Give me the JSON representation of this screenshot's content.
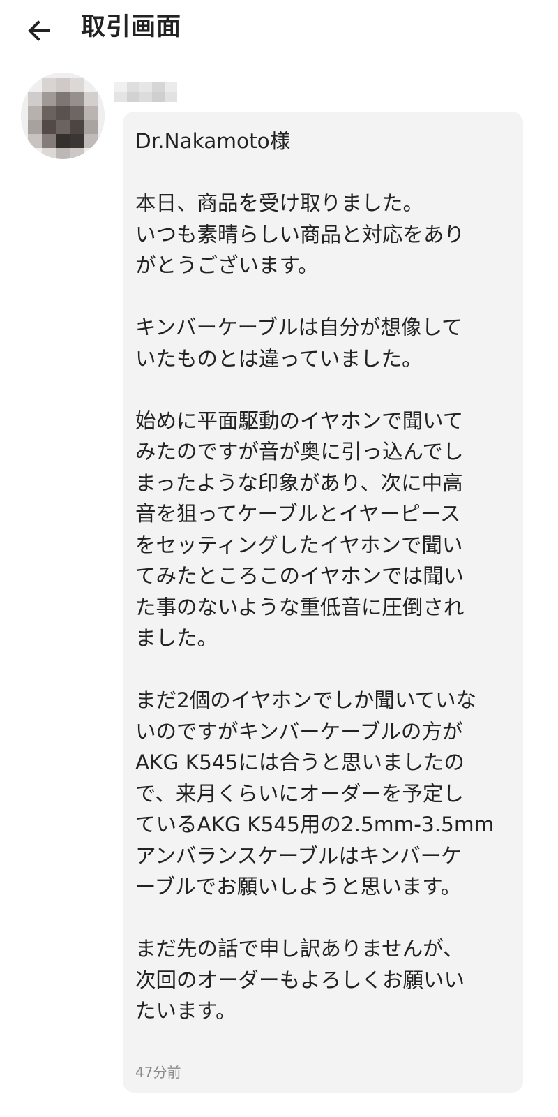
{
  "app_bar": {
    "title": "取引画面",
    "back_icon": "arrow-left-icon"
  },
  "message": {
    "sender": {
      "avatar_icon": "avatar",
      "name_pixelated": true
    },
    "text": "Dr.Nakamoto様\n\n本日、商品を受け取りました。\nいつも素晴らしい商品と対応をあり\nがとうございます。\n\nキンバーケーブルは自分が想像して\nいたものとは違っていました。\n\n始めに平面駆動のイヤホンで聞いて\nみたのですが音が奥に引っ込んでし\nまったような印象があり、次に中高\n音を狙ってケーブルとイヤーピース\nをセッティングしたイヤホンで聞い\nてみたところこのイヤホンでは聞い\nた事のないような重低音に圧倒され\nました。\n\nまだ2個のイヤホンでしか聞いていな\nいのですがキンバーケーブルの方が\nAKG K545には合うと思いましたの\nで、来月くらいにオーダーを予定し\nているAKG K545用の2.5mm-3.5mm\nアンバランスケーブルはキンバーケ\nーブルでお願いしようと思います。\n\nまだ先の話で申し訳ありませんが、\n次回のオーダーもよろしくお願いい\nたいます。",
    "timestamp": "47分前"
  },
  "colors": {
    "background": "#ffffff",
    "bubble": "#f3f3f3",
    "text": "#222222",
    "timestamp": "#8a8a8a",
    "divider": "#d4d4d4"
  }
}
